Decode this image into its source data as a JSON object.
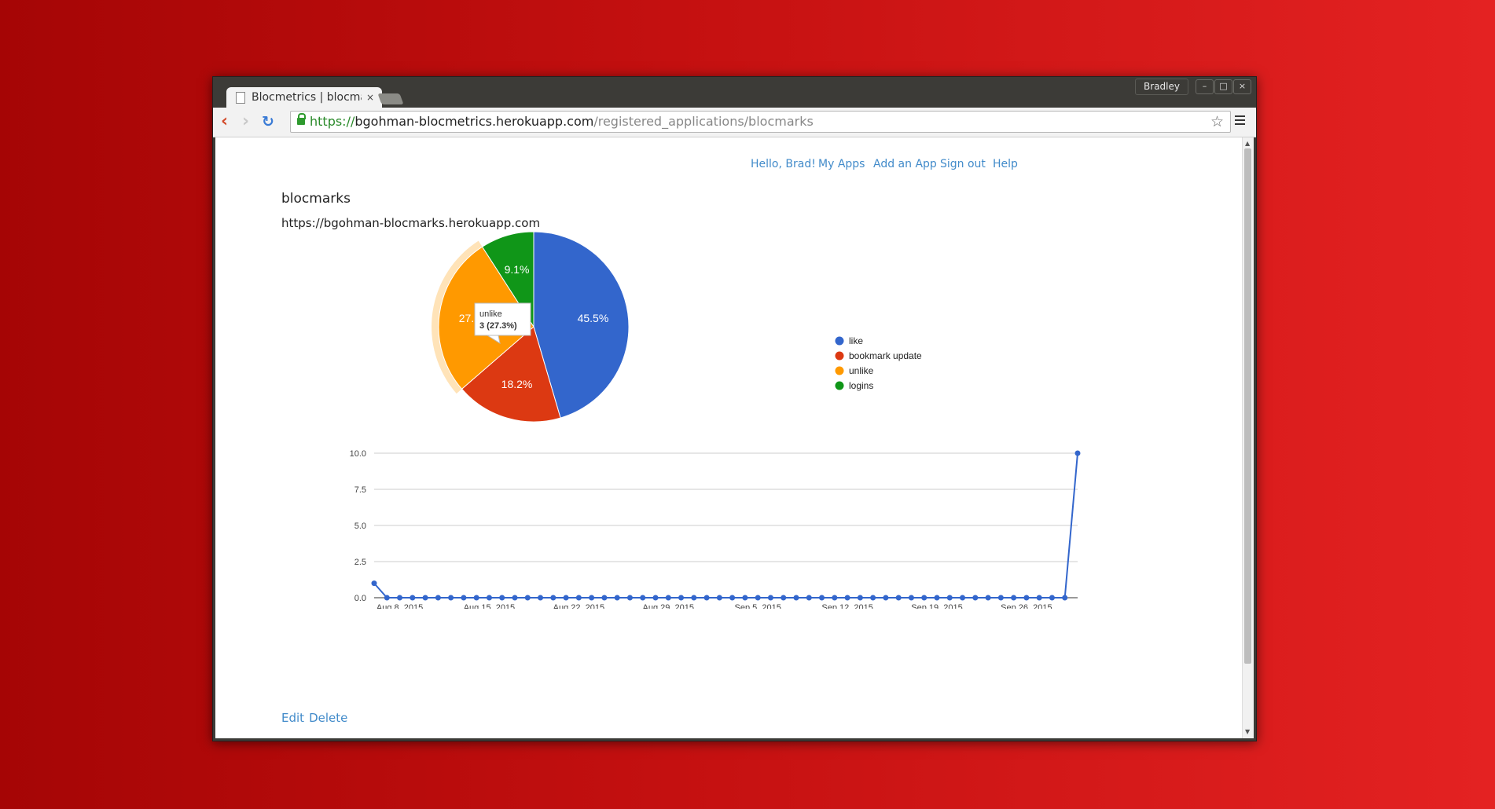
{
  "window": {
    "user_label": "Bradley",
    "controls": [
      "–",
      "□",
      "×"
    ]
  },
  "tab": {
    "title": "Blocmetrics | blocmarks",
    "close": "×"
  },
  "address_bar": {
    "scheme": "https://",
    "host": "bgohman-blocmetrics.herokuapp.com",
    "path": "/registered_applications/blocmarks"
  },
  "toolbar": {
    "back": "‹",
    "forward": "›",
    "reload": "↻",
    "star": "☆"
  },
  "nav": {
    "greeting": "Hello, Brad!",
    "my_apps": "My Apps",
    "add_app": "Add an App",
    "sign_out": "Sign out",
    "help": "Help"
  },
  "app": {
    "name": "blocmarks",
    "url": "https://bgohman-blocmarks.herokuapp.com"
  },
  "actions": {
    "edit": "Edit",
    "delete": "Delete"
  },
  "chart_data": [
    {
      "type": "pie",
      "slices": [
        {
          "name": "like",
          "value": 5,
          "label": "45.5%",
          "color": "#3366cc"
        },
        {
          "name": "bookmark update",
          "value": 2,
          "label": "18.2%",
          "color": "#dc3912"
        },
        {
          "name": "unlike",
          "value": 3,
          "label": "27.3%",
          "color": "#ff9900"
        },
        {
          "name": "logins",
          "value": 1,
          "label": "9.1%",
          "color": "#109618"
        }
      ],
      "legend_position": "right",
      "tooltip": {
        "title": "unlike",
        "value": "3 (27.3%)"
      }
    },
    {
      "type": "line",
      "color": "#3366cc",
      "ylim": [
        0,
        10
      ],
      "yticks": [
        "0.0",
        "2.5",
        "5.0",
        "7.5",
        "10.0"
      ],
      "xrange": [
        "2015-08-06",
        "2015-09-30"
      ],
      "xticks": [
        "Aug 8, 2015",
        "Aug 15, 2015",
        "Aug 22, 2015",
        "Aug 29, 2015",
        "Sep 5, 2015",
        "Sep 12, 2015",
        "Sep 19, 2015",
        "Sep 26, 2015"
      ],
      "x": [
        "2015-08-06",
        "2015-08-07",
        "2015-08-08",
        "2015-08-09",
        "2015-08-10",
        "2015-08-11",
        "2015-08-12",
        "2015-08-13",
        "2015-08-14",
        "2015-08-15",
        "2015-08-16",
        "2015-08-17",
        "2015-08-18",
        "2015-08-19",
        "2015-08-20",
        "2015-08-21",
        "2015-08-22",
        "2015-08-23",
        "2015-08-24",
        "2015-08-25",
        "2015-08-26",
        "2015-08-27",
        "2015-08-28",
        "2015-08-29",
        "2015-08-30",
        "2015-08-31",
        "2015-09-01",
        "2015-09-02",
        "2015-09-03",
        "2015-09-04",
        "2015-09-05",
        "2015-09-06",
        "2015-09-07",
        "2015-09-08",
        "2015-09-09",
        "2015-09-10",
        "2015-09-11",
        "2015-09-12",
        "2015-09-13",
        "2015-09-14",
        "2015-09-15",
        "2015-09-16",
        "2015-09-17",
        "2015-09-18",
        "2015-09-19",
        "2015-09-20",
        "2015-09-21",
        "2015-09-22",
        "2015-09-23",
        "2015-09-24",
        "2015-09-25",
        "2015-09-26",
        "2015-09-27",
        "2015-09-28",
        "2015-09-29",
        "2015-09-30"
      ],
      "y": [
        1,
        0,
        0,
        0,
        0,
        0,
        0,
        0,
        0,
        0,
        0,
        0,
        0,
        0,
        0,
        0,
        0,
        0,
        0,
        0,
        0,
        0,
        0,
        0,
        0,
        0,
        0,
        0,
        0,
        0,
        0,
        0,
        0,
        0,
        0,
        0,
        0,
        0,
        0,
        0,
        0,
        0,
        0,
        0,
        0,
        0,
        0,
        0,
        0,
        0,
        0,
        0,
        0,
        0,
        0,
        10
      ]
    }
  ]
}
